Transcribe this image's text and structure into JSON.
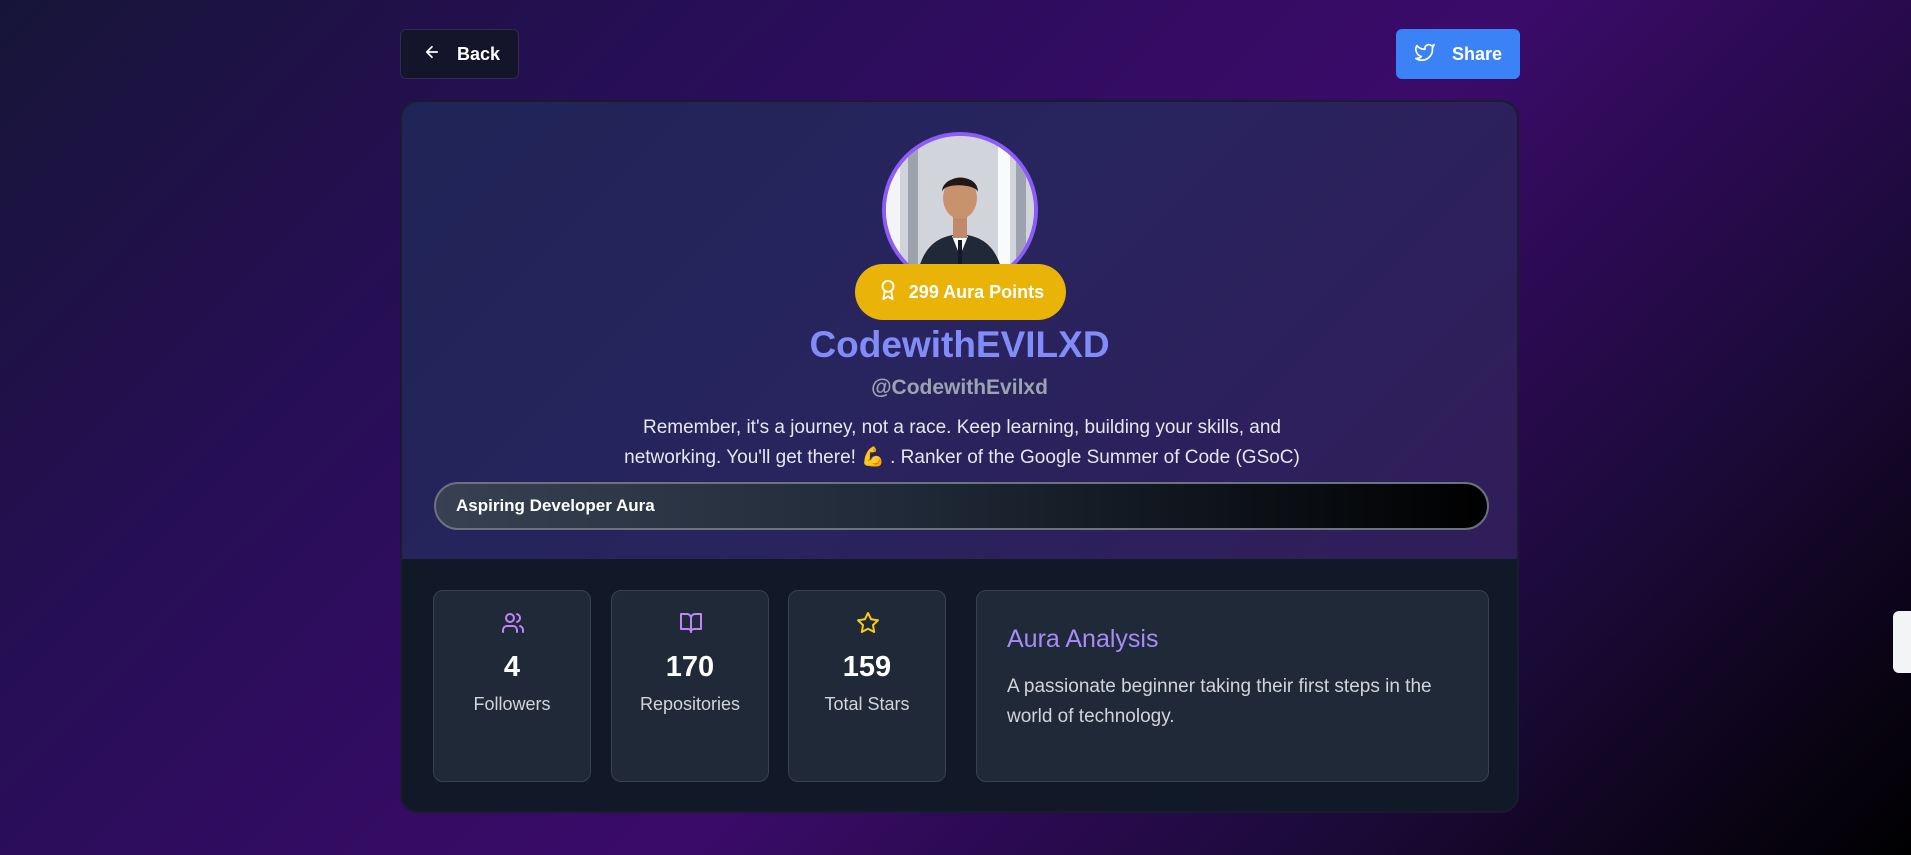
{
  "header": {
    "back_label": "Back",
    "share_label": "Share"
  },
  "profile": {
    "avatar_alt": "profile photo",
    "aura_points": "299 Aura Points",
    "display_name": "CodewithEVILXD",
    "username": "@CodewithEvilxd",
    "bio": "Remember, it's a journey, not a race. Keep learning, building your skills, and networking. You'll get there! 💪 . Ranker of the Google Summer of Code (GSoC)",
    "aura_level": "Aspiring Developer Aura"
  },
  "stats": [
    {
      "icon": "users-icon",
      "value": "4",
      "label": "Followers"
    },
    {
      "icon": "book-icon",
      "value": "170",
      "label": "Repositories"
    },
    {
      "icon": "star-icon",
      "value": "159",
      "label": "Total Stars"
    }
  ],
  "analysis": {
    "title": "Aura Analysis",
    "text": "A passionate beginner taking their first steps in the world of technology."
  },
  "colors": {
    "accent_purple": "#8b5cf6",
    "name_color": "#818cf8",
    "badge_yellow": "#eab308",
    "share_blue": "#3b82f6",
    "star_yellow": "#facc15",
    "icon_purple": "#c084fc"
  }
}
